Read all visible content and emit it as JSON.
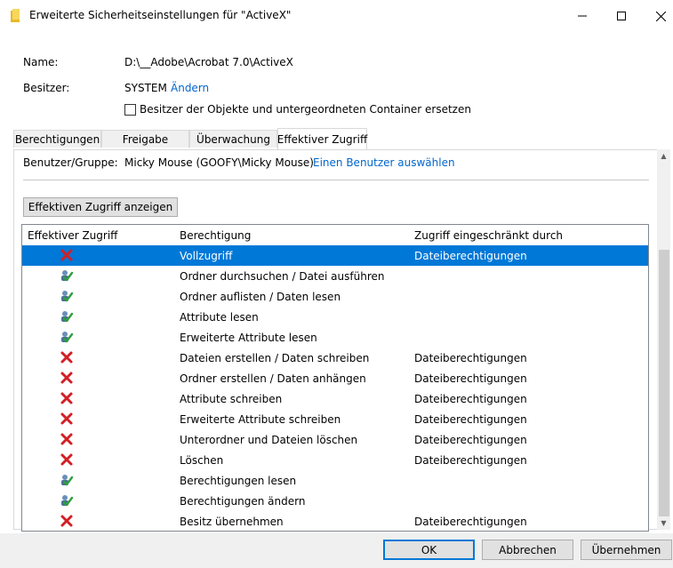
{
  "window": {
    "title": "Erweiterte Sicherheitseinstellungen für \"ActiveX\"",
    "minimize_icon": "minimize-icon",
    "maximize_icon": "maximize-icon",
    "close_icon": "close-icon"
  },
  "info": {
    "name_label": "Name:",
    "name_value": "D:\\__Adobe\\Acrobat 7.0\\ActiveX",
    "owner_label": "Besitzer:",
    "owner_value": "SYSTEM",
    "owner_change_link": "Ändern",
    "replace_owner_checkbox_label": "Besitzer der Objekte und untergeordneten Container ersetzen",
    "replace_owner_checked": false
  },
  "tabs": [
    {
      "label": "Berechtigungen",
      "active": false
    },
    {
      "label": "Freigabe",
      "active": false
    },
    {
      "label": "Überwachung",
      "active": false
    },
    {
      "label": "Effektiver Zugriff",
      "active": true
    }
  ],
  "effective": {
    "user_group_label": "Benutzer/Gruppe:",
    "user_group_value": "Micky Mouse (GOOFY\\Micky Mouse)",
    "select_user_link": "Einen Benutzer auswählen",
    "show_button": "Effektiven Zugriff anzeigen"
  },
  "table": {
    "columns": [
      "Effektiver Zugriff",
      "Berechtigung",
      "Zugriff eingeschränkt durch"
    ],
    "rows": [
      {
        "access": "denied",
        "permission": "Vollzugriff",
        "restricted_by": "Dateiberechtigungen",
        "selected": true
      },
      {
        "access": "allowed",
        "permission": "Ordner durchsuchen / Datei ausführen",
        "restricted_by": ""
      },
      {
        "access": "allowed",
        "permission": "Ordner auflisten / Daten lesen",
        "restricted_by": ""
      },
      {
        "access": "allowed",
        "permission": "Attribute lesen",
        "restricted_by": ""
      },
      {
        "access": "allowed",
        "permission": "Erweiterte Attribute lesen",
        "restricted_by": ""
      },
      {
        "access": "denied",
        "permission": "Dateien erstellen / Daten schreiben",
        "restricted_by": "Dateiberechtigungen"
      },
      {
        "access": "denied",
        "permission": "Ordner erstellen / Daten anhängen",
        "restricted_by": "Dateiberechtigungen"
      },
      {
        "access": "denied",
        "permission": "Attribute schreiben",
        "restricted_by": "Dateiberechtigungen"
      },
      {
        "access": "denied",
        "permission": "Erweiterte Attribute schreiben",
        "restricted_by": "Dateiberechtigungen"
      },
      {
        "access": "denied",
        "permission": "Unterordner und Dateien löschen",
        "restricted_by": "Dateiberechtigungen"
      },
      {
        "access": "denied",
        "permission": "Löschen",
        "restricted_by": "Dateiberechtigungen"
      },
      {
        "access": "allowed",
        "permission": "Berechtigungen lesen",
        "restricted_by": ""
      },
      {
        "access": "allowed",
        "permission": "Berechtigungen ändern",
        "restricted_by": ""
      },
      {
        "access": "denied",
        "permission": "Besitz übernehmen",
        "restricted_by": "Dateiberechtigungen"
      }
    ]
  },
  "buttons": {
    "ok": "OK",
    "cancel": "Abbrechen",
    "apply": "Übernehmen"
  },
  "colors": {
    "selection": "#0078d7",
    "link": "#0066cc",
    "denied": "#d21f26",
    "allowed": "#2e9e3e"
  }
}
